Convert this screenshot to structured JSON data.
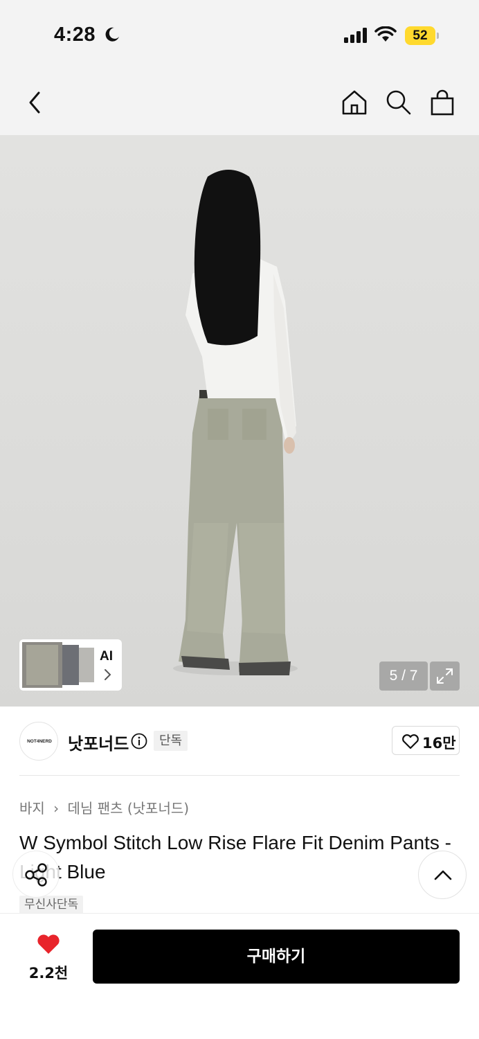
{
  "status_bar": {
    "time": "4:28",
    "battery": "52",
    "battery_color": "#ffd92e"
  },
  "nav": {
    "icons": [
      "back-arrow-icon",
      "home-icon",
      "search-icon",
      "shopping-bag-icon"
    ]
  },
  "gallery": {
    "ai_label": "AI",
    "counter": "5 / 7",
    "expand_icon": "expand-icon"
  },
  "brand": {
    "logo_text": "NOT4NERD",
    "name": "낫포너드",
    "tag": "단독",
    "like_count": "16만"
  },
  "product": {
    "breadcrumb": {
      "category": "바지",
      "subcategory": "데님 팬츠 (낫포너드)"
    },
    "title": "W Symbol Stitch Low Rise Flare Fit Denim Pants - Light Blue",
    "badge": "무신사단독"
  },
  "bottom_bar": {
    "like_count": "2.2천",
    "like_color": "#e8242b",
    "buy_label": "구매하기"
  }
}
